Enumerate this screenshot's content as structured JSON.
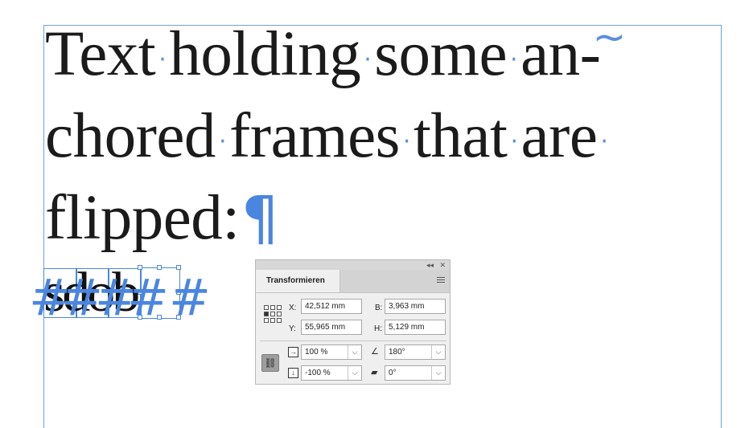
{
  "document": {
    "line1": {
      "w1": "Text",
      "w2": "holding",
      "w3": "some",
      "w4": "an-"
    },
    "line2": {
      "w1": "chored",
      "w2": "frames",
      "w3": "that",
      "w4": "are"
    },
    "line3": "flipped:",
    "anchored_text": "sdob",
    "space_marker": "·",
    "hyphen_marker": "~",
    "paragraph_marker": "¶",
    "anchor_marker": "#"
  },
  "panel": {
    "title": "Transformieren",
    "collapse_glyph": "◂◂",
    "close_glyph": "✕",
    "x_label": "X:",
    "x_value": "42,512 mm",
    "y_label": "Y:",
    "y_value": "55,965 mm",
    "b_label": "B:",
    "b_value": "3,963 mm",
    "h_label": "H:",
    "h_value": "5,129 mm",
    "scale_x": "100 %",
    "scale_y": "-100 %",
    "rotation": "180°",
    "shear": "0°",
    "dropdown_glyph": "⌵",
    "chain_glyph": "⛓",
    "rotate_icon_glyph": "∠",
    "shear_icon_glyph": "▰"
  },
  "colors": {
    "frame": "#6ea0e3",
    "marker": "#4a86e0",
    "panel_bg": "#efefef"
  }
}
